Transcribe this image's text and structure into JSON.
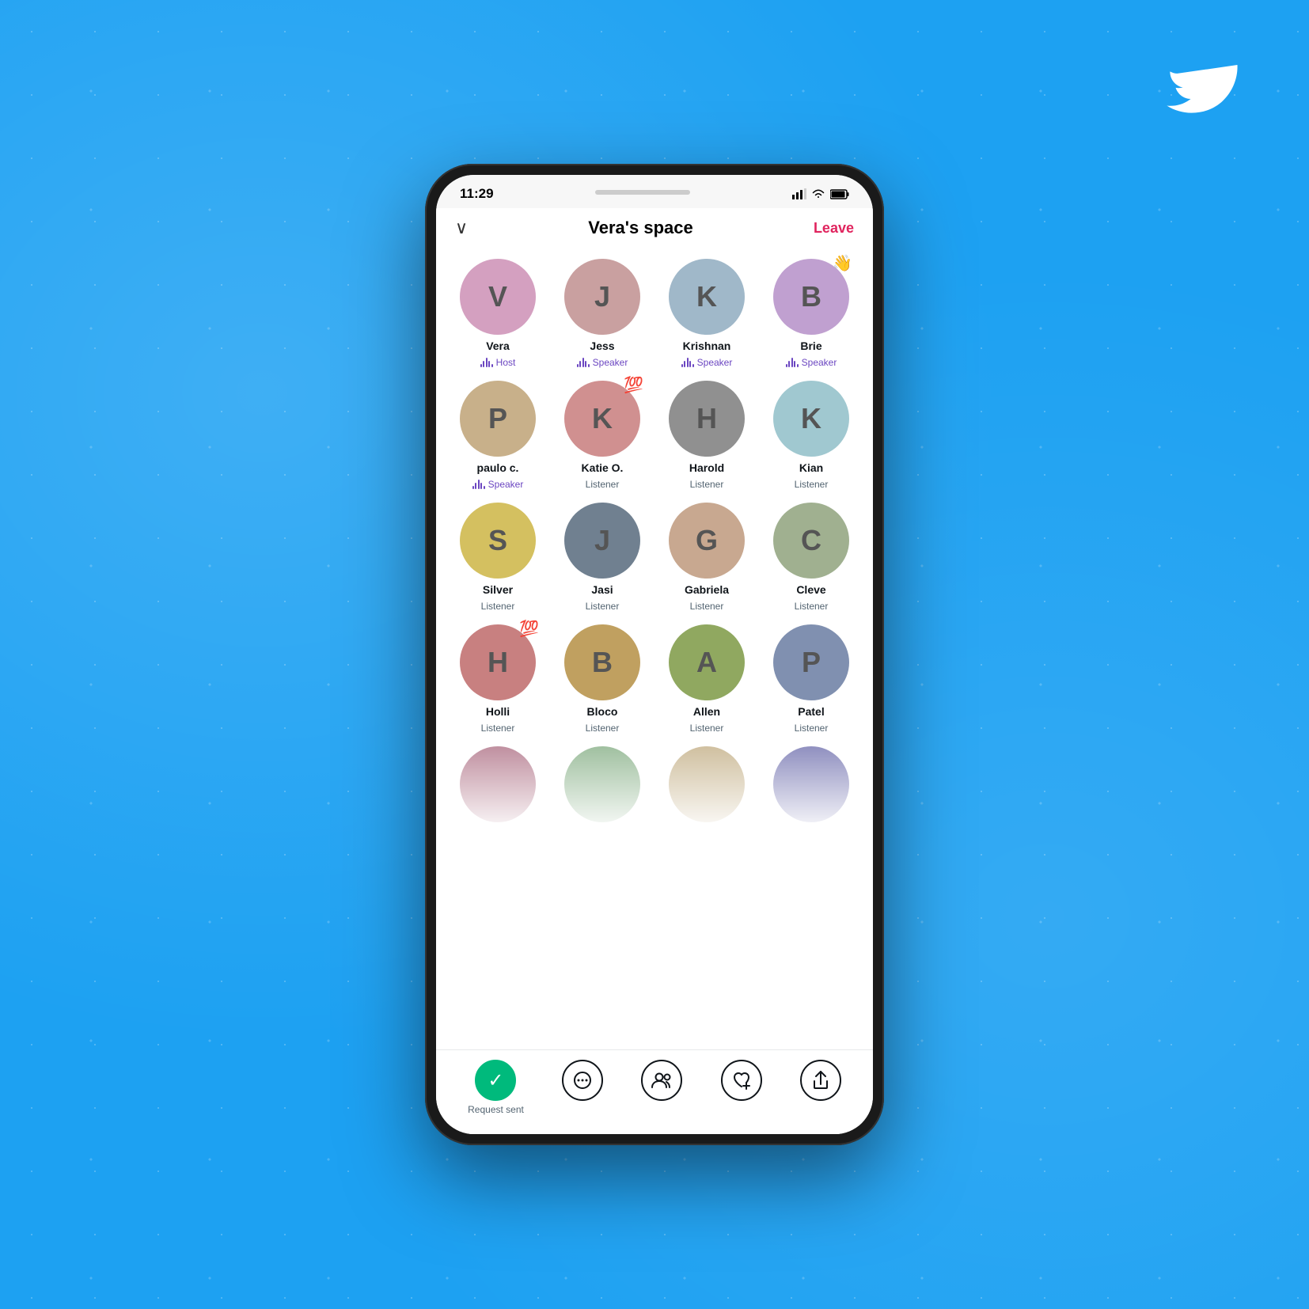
{
  "status_bar": {
    "time": "11:29"
  },
  "header": {
    "title": "Vera's space",
    "chevron": "∨",
    "leave_label": "Leave"
  },
  "participants": [
    {
      "name": "Vera",
      "role": "Host",
      "is_speaker": true,
      "emoji": null,
      "av_class": "av-vera",
      "initials": "V"
    },
    {
      "name": "Jess",
      "role": "Speaker",
      "is_speaker": true,
      "emoji": null,
      "av_class": "av-jess",
      "initials": "J"
    },
    {
      "name": "Krishnan",
      "role": "Speaker",
      "is_speaker": true,
      "emoji": null,
      "av_class": "av-krishnan",
      "initials": "K"
    },
    {
      "name": "Brie",
      "role": "Speaker",
      "is_speaker": true,
      "emoji": "👋",
      "av_class": "av-brie",
      "initials": "B"
    },
    {
      "name": "paulo c.",
      "role": "Speaker",
      "is_speaker": true,
      "emoji": null,
      "av_class": "av-paulo",
      "initials": "P"
    },
    {
      "name": "Katie O.",
      "role": "Listener",
      "is_speaker": false,
      "emoji": "💯",
      "av_class": "av-katie",
      "initials": "K"
    },
    {
      "name": "Harold",
      "role": "Listener",
      "is_speaker": false,
      "emoji": null,
      "av_class": "av-harold",
      "initials": "H"
    },
    {
      "name": "Kian",
      "role": "Listener",
      "is_speaker": false,
      "emoji": null,
      "av_class": "av-kian",
      "initials": "K"
    },
    {
      "name": "Silver",
      "role": "Listener",
      "is_speaker": false,
      "emoji": null,
      "av_class": "av-silver",
      "initials": "S"
    },
    {
      "name": "Jasi",
      "role": "Listener",
      "is_speaker": false,
      "emoji": null,
      "av_class": "av-jasi",
      "initials": "J"
    },
    {
      "name": "Gabriela",
      "role": "Listener",
      "is_speaker": false,
      "emoji": null,
      "av_class": "av-gabriela",
      "initials": "G"
    },
    {
      "name": "Cleve",
      "role": "Listener",
      "is_speaker": false,
      "emoji": null,
      "av_class": "av-cleve",
      "initials": "C"
    },
    {
      "name": "Holli",
      "role": "Listener",
      "is_speaker": false,
      "emoji": "💯",
      "av_class": "av-holli",
      "initials": "H"
    },
    {
      "name": "Bloco",
      "role": "Listener",
      "is_speaker": false,
      "emoji": null,
      "av_class": "av-bloco",
      "initials": "B"
    },
    {
      "name": "Allen",
      "role": "Listener",
      "is_speaker": false,
      "emoji": null,
      "av_class": "av-allen",
      "initials": "A"
    },
    {
      "name": "Patel",
      "role": "Listener",
      "is_speaker": false,
      "emoji": null,
      "av_class": "av-patel",
      "initials": "P"
    }
  ],
  "partial_row": [
    {
      "av_class": "av-p1",
      "initials": "?"
    },
    {
      "av_class": "av-p2",
      "initials": "?"
    },
    {
      "av_class": "av-p3",
      "initials": "?"
    },
    {
      "av_class": "av-p4",
      "initials": "?"
    }
  ],
  "bottom_bar": {
    "request_label": "Request sent",
    "check_icon": "✓",
    "bubbles_icon": "···",
    "people_icon": "👥",
    "heart_icon": "♡+",
    "share_icon": "↑"
  }
}
